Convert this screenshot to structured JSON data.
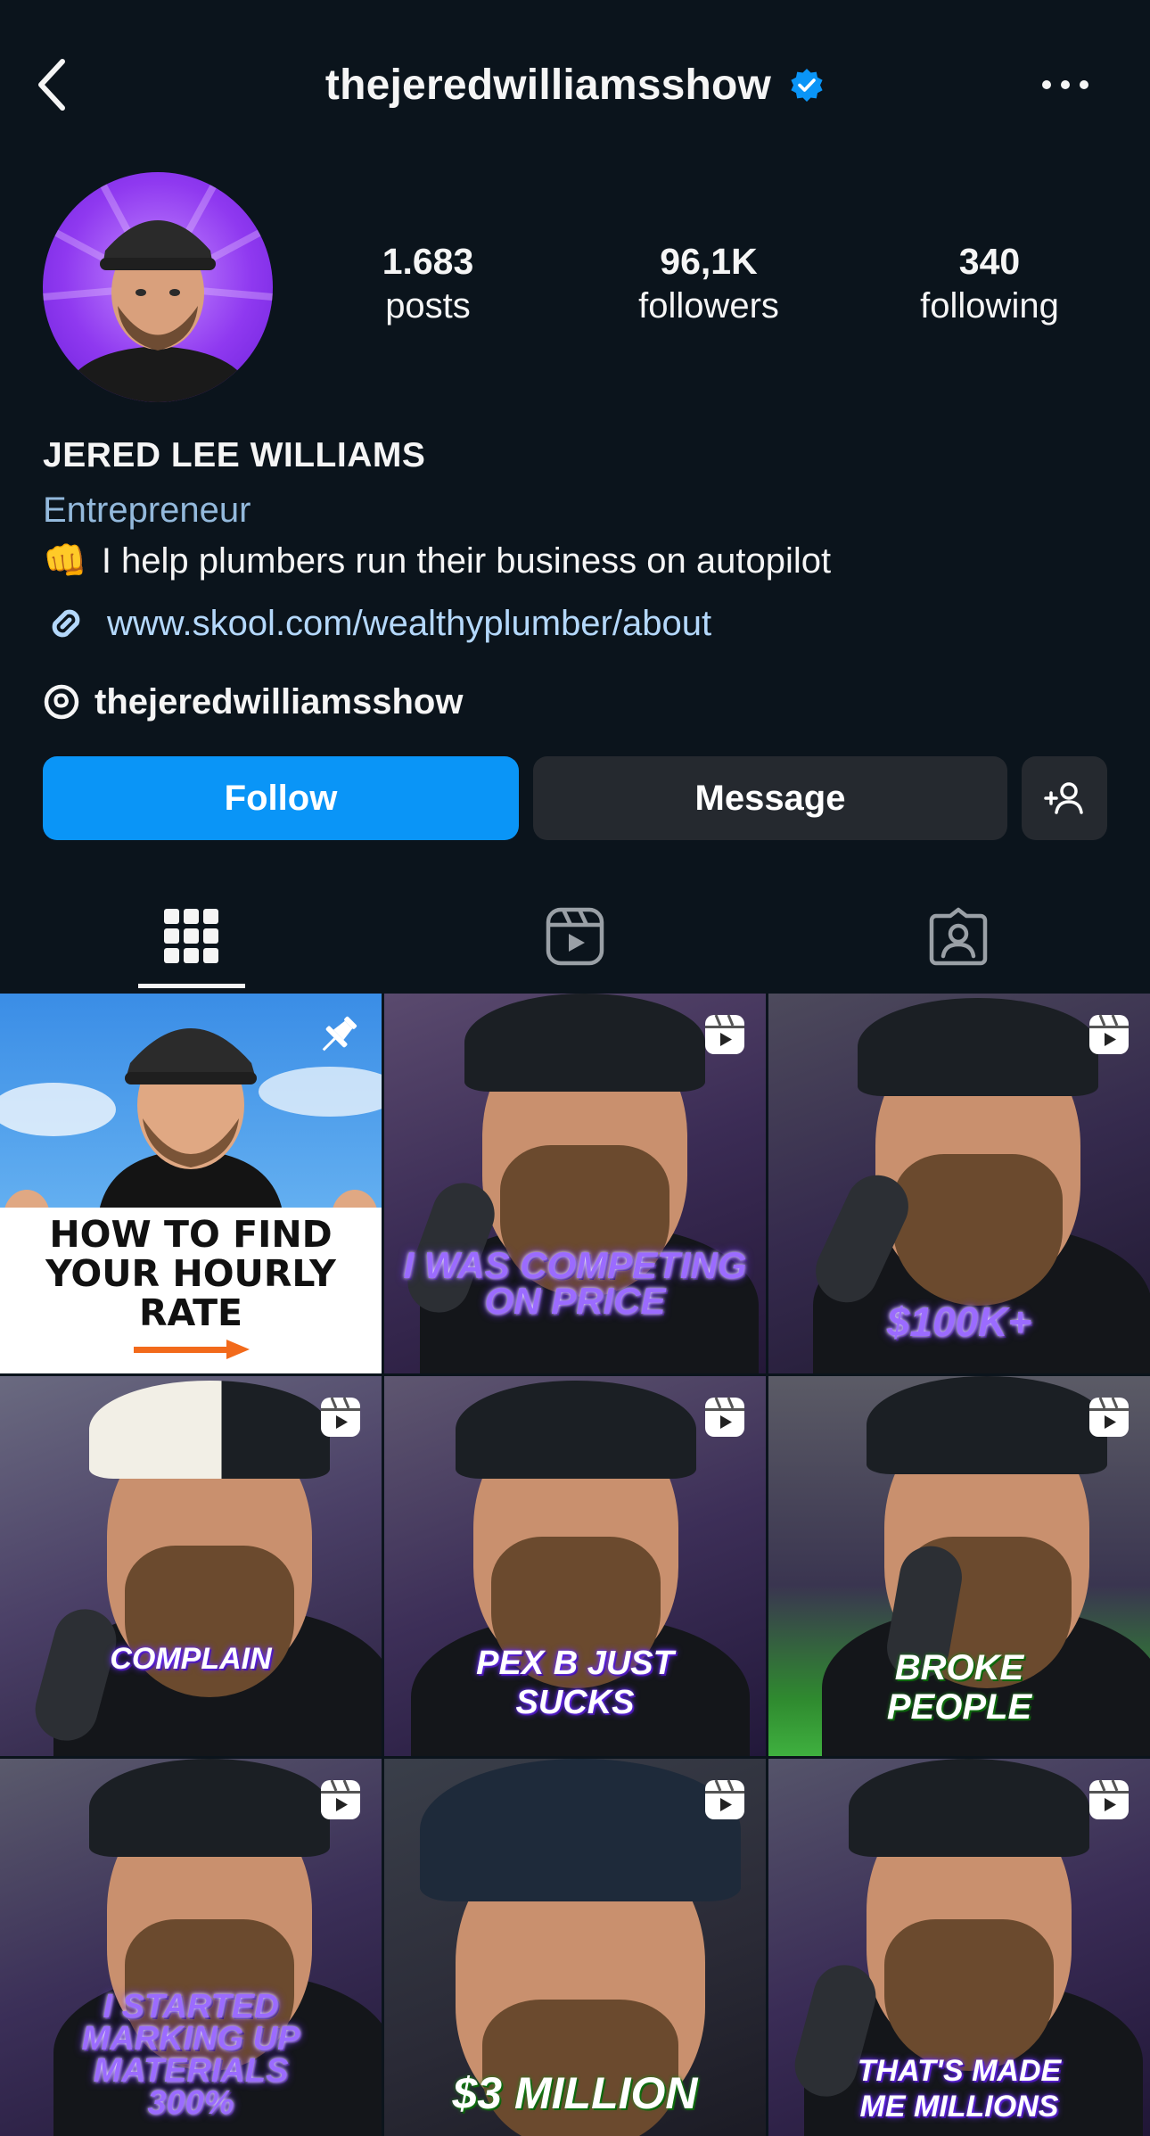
{
  "header": {
    "username": "thejeredwilliamsshow"
  },
  "stats": {
    "posts": {
      "value": "1.683",
      "label": "posts"
    },
    "followers": {
      "value": "96,1K",
      "label": "followers"
    },
    "following": {
      "value": "340",
      "label": "following"
    }
  },
  "bio": {
    "name": "JERED LEE WILLIAMS",
    "category": "Entrepreneur",
    "line": "I help plumbers run their business on autopilot",
    "emoji": "👊",
    "link": "www.skool.com/wealthyplumber/about",
    "threads_handle": "thejeredwilliamsshow"
  },
  "actions": {
    "follow": "Follow",
    "message": "Message"
  },
  "colors": {
    "background": "#0b141c",
    "follow_button": "#0a95f7",
    "secondary_button": "#25292f",
    "link": "#b4d8fb",
    "category": "#93b9dc",
    "verified": "#0a95f7"
  },
  "tabs": [
    "grid-icon",
    "reels-icon",
    "tagged-icon"
  ],
  "posts": [
    {
      "type": "pinned",
      "caption": "HOW TO FIND YOUR HOURLY RATE"
    },
    {
      "type": "reel",
      "caption": "I WAS COMPETING ON PRICE"
    },
    {
      "type": "reel",
      "caption": "$100K+"
    },
    {
      "type": "reel",
      "caption": "COMPLAIN"
    },
    {
      "type": "reel",
      "caption": "PEX B JUST SUCKS"
    },
    {
      "type": "reel",
      "caption": "BROKE PEOPLE"
    },
    {
      "type": "reel",
      "caption": "I STARTED MARKING UP MATERIALS 300%"
    },
    {
      "type": "reel",
      "caption": "$3 MILLION"
    },
    {
      "type": "reel",
      "caption": "THAT'S MADE ME MILLIONS"
    }
  ]
}
